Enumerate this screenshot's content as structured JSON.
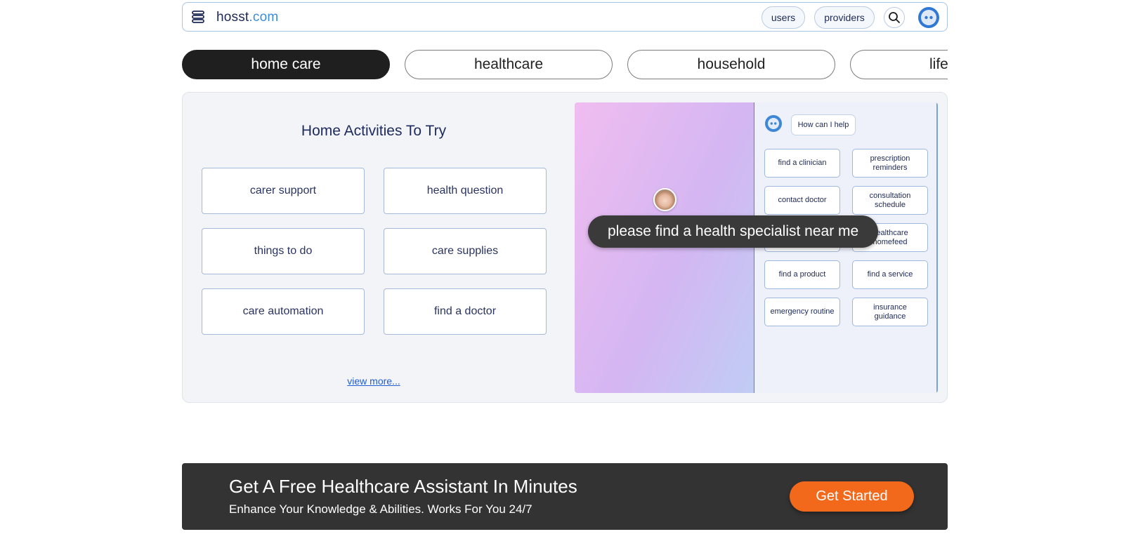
{
  "header": {
    "brand_name": "hosst",
    "brand_tld": ".com",
    "nav": [
      "users",
      "providers"
    ],
    "menu_icon": "menu-icon",
    "search_icon": "search-icon",
    "avatar_icon": "assistant-avatar-icon"
  },
  "categories": [
    {
      "label": "home care",
      "active": true
    },
    {
      "label": "healthcare",
      "active": false
    },
    {
      "label": "household",
      "active": false
    },
    {
      "label": "lifestyle",
      "active": false
    }
  ],
  "panel": {
    "title": "Home Activities To Try",
    "activities": [
      "carer support",
      "health question",
      "things to do",
      "care supplies",
      "care automation",
      "find a doctor"
    ],
    "view_more": "view more..."
  },
  "illustration": {
    "help_prompt": "How can I help",
    "chips": [
      "find a clinician",
      "prescription reminders",
      "contact doctor",
      "consultation schedule",
      "",
      "healthcare homefeed",
      "find a product",
      "find a service",
      "emergency routine",
      "insurance guidance"
    ],
    "speech": "please find a health specialist near me"
  },
  "cta": {
    "title": "Get A Free Healthcare Assistant In Minutes",
    "subtitle": "Enhance Your Knowledge & Abilities. Works For You 24/7",
    "button": "Get Started",
    "button_color": "#f2691c",
    "background": "#333333"
  }
}
